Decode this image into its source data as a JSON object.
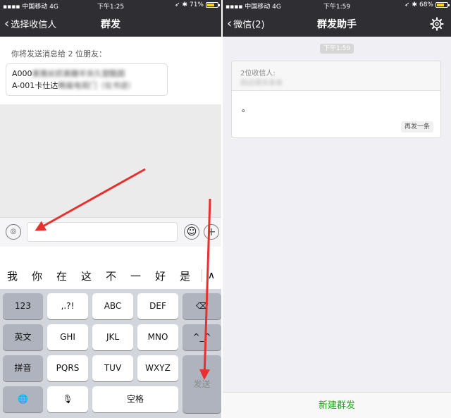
{
  "left": {
    "status": {
      "carrier": "中国移动",
      "network": "4G",
      "time": "下午1:25",
      "battery": "71%",
      "battery_level": 0.71
    },
    "nav": {
      "back_label": "选择收信人",
      "title": "群发"
    },
    "recipients": {
      "prompt": "你将发送消息给 2 位朋友：",
      "line1_visible": "A000",
      "line1_blurred": "美雅丝抓美糖羊央久塑酷题",
      "line2_visible": "A-001卡仕达",
      "line2_blurred": "畴属电观门（化书迹）"
    },
    "input_bar": {
      "text": ""
    },
    "candidates": [
      "我",
      "你",
      "在",
      "这",
      "不",
      "一",
      "好",
      "是"
    ],
    "keyboard": {
      "row1": [
        "123",
        ",.?!",
        "ABC",
        "DEF"
      ],
      "row2": [
        "英文",
        "GHI",
        "JKL",
        "MNO"
      ],
      "row3": [
        "拼音",
        "PQRS",
        "TUV",
        "WXYZ"
      ],
      "row4_space": "空格",
      "send": "发送"
    }
  },
  "right": {
    "status": {
      "carrier": "中国移动",
      "network": "4G",
      "time": "下午1:59",
      "battery": "68%",
      "battery_level": 0.68
    },
    "nav": {
      "back_label": "微信(2)",
      "title": "群发助手"
    },
    "time_label": "下午1:59",
    "message": {
      "recipient_count": "2位收信人:",
      "recipient_names_blurred": "别过得天幸幸",
      "body": "。",
      "resend_label": "再发一条"
    },
    "new_mass_label": "新建群发"
  },
  "colors": {
    "nav_bg": "#2e2e33",
    "wechat_green": "#1aad19",
    "arrow_red": "#e8312f"
  }
}
